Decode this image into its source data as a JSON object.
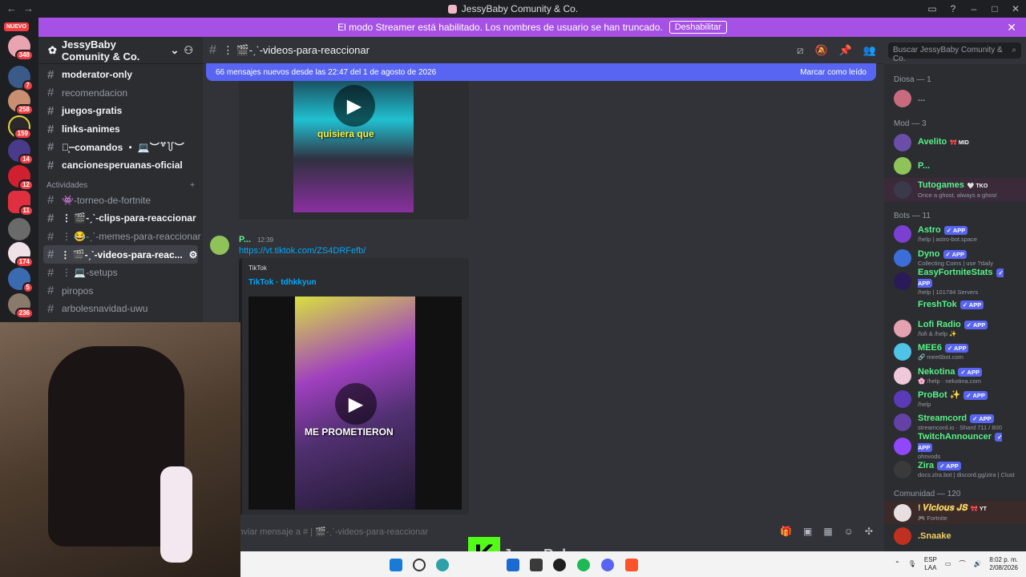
{
  "window": {
    "title": "JessyBaby Comunity & Co."
  },
  "servers": {
    "nuevo": "NUEVO",
    "badges": [
      "348",
      "7",
      "258",
      "159",
      "14",
      "12",
      "11",
      "174",
      "5",
      "236"
    ]
  },
  "streamer_banner": {
    "text": "El modo Streamer está habilitado. Los nombres de usuario se han truncado.",
    "button": "Deshabilitar"
  },
  "guild": {
    "name": "JessyBaby Comunity & Co."
  },
  "channels": [
    {
      "label": "moderator-only",
      "unread": true
    },
    {
      "label": "recomendacion",
      "unread": false
    },
    {
      "label": "juegos-gratis",
      "unread": true
    },
    {
      "label": "links-animes",
      "unread": true
    },
    {
      "label": "╰͙┈comandos ・ 💻︶꒷꒦︶",
      "unread": true
    },
    {
      "label": "cancionesperuanas-oficial",
      "unread": true
    }
  ],
  "category": {
    "label": "Actividades"
  },
  "activity_channels": [
    {
      "label": "👾-torneo-de-fortnite",
      "unread": false
    },
    {
      "label": "⋮ 🎬-ˏˋ-clips-para-reaccionar",
      "unread": true
    },
    {
      "label": "⋮ 😂-ˏˋ-memes-para-reaccionar",
      "unread": false
    },
    {
      "label": "⋮ 🎬-ˏˋ-videos-para-reac...",
      "unread": true,
      "active": true
    },
    {
      "label": "⋮ 💻-setups",
      "unread": false
    },
    {
      "label": "piropos",
      "unread": false
    },
    {
      "label": "arbolesnavidad-uwu",
      "unread": false
    }
  ],
  "channel_header": {
    "name": "⋮ 🎬-ˏˋ-videos-para-reaccionar"
  },
  "search": {
    "placeholder": "Buscar JessyBaby Comunity & Co."
  },
  "new_messages": {
    "text": "66 mensajes nuevos desde las 22:47 del 1 de agosto de 2026",
    "action": "Marcar como leído"
  },
  "messages": {
    "video1_caption": "quisiera que",
    "author": "P...",
    "time": "12:39",
    "link": "https://vt.tiktok.com/ZS4DRFefb/",
    "embed_provider": "TikTok",
    "embed_title": "TikTok · tdhkkyun",
    "video2_caption": "ME PROMETIERON"
  },
  "composer": {
    "placeholder": "Enviar mensaje a # | 🎬-ˏˋ-videos-para-reaccionar"
  },
  "members": {
    "groups": [
      {
        "label": "Diosa — 1",
        "members": [
          {
            "name": "...",
            "sub": "",
            "tag": "",
            "color": "#949ba4",
            "avatar": "#c86b7f"
          }
        ]
      },
      {
        "label": "Mod — 3",
        "members": [
          {
            "name": "Avelito",
            "sub": "",
            "tag": "🎀 MID",
            "color": "#57f287",
            "avatar": "#6b4ea8"
          },
          {
            "name": "P...",
            "sub": "",
            "tag": "",
            "color": "#57f287",
            "avatar": "#8fc35a"
          },
          {
            "name": "Tutogames",
            "sub": "Once a ghost, always a ghost",
            "tag": "🤍 TKO",
            "color": "#57f287",
            "avatar": "#3a3a4a"
          }
        ]
      },
      {
        "label": "Bots — 11",
        "members": [
          {
            "name": "Astro",
            "sub": "/help | astro-bot.space",
            "tag": "✓ APP",
            "color": "#57f287",
            "avatar": "#7b3fd1"
          },
          {
            "name": "Dyno",
            "sub": "Collecting Coins | use ?daily",
            "tag": "✓ APP",
            "color": "#57f287",
            "avatar": "#3b6ed8"
          },
          {
            "name": "EasyFortniteStats",
            "sub": "/help | 101784 Servers",
            "tag": "✓ APP",
            "color": "#57f287",
            "avatar": "#2a1a5a"
          },
          {
            "name": "FreshTok",
            "sub": "",
            "tag": "✓ APP",
            "color": "#57f287",
            "avatar": "#2b2d31"
          },
          {
            "name": "Lofi Radio",
            "sub": "/lofi & /help ✨",
            "tag": "✓ APP",
            "color": "#57f287",
            "avatar": "#e4a1b0"
          },
          {
            "name": "MEE6",
            "sub": "🔗 mee6bot.com",
            "tag": "✓ APP",
            "color": "#57f287",
            "avatar": "#4fc3e8"
          },
          {
            "name": "Nekotina",
            "sub": "🌸 /help · nekotina.com",
            "tag": "✓ APP",
            "color": "#57f287",
            "avatar": "#f0c8d8"
          },
          {
            "name": "ProBot ✨",
            "sub": "/help",
            "tag": "✓ APP",
            "color": "#57f287",
            "avatar": "#5a3ab8"
          },
          {
            "name": "Streamcord",
            "sub": "streamcord.io · Shard 711 / 800",
            "tag": "✓ APP",
            "color": "#57f287",
            "avatar": "#6441a5"
          },
          {
            "name": "TwitchAnnouncer",
            "sub": "ohnvods",
            "tag": "✓ APP",
            "color": "#57f287",
            "avatar": "#9146ff"
          },
          {
            "name": "Zira",
            "sub": "docs.zira.bot | discord.gg/zira | Clust",
            "tag": "✓ APP",
            "color": "#57f287",
            "avatar": "#3a3a3a"
          }
        ]
      },
      {
        "label": "Comunidad — 120",
        "members": [
          {
            "name": "! 𝑽𝒊𝒄𝒊𝒐𝒖𝒔 𝑱𝑺",
            "sub": "🎮 Fortnite",
            "tag": "🎀 YT",
            "color": "#f0d060",
            "avatar": "#e8e0e0"
          },
          {
            "name": ".Snaake",
            "sub": "",
            "tag": "",
            "color": "#f0d060",
            "avatar": "#c03020"
          }
        ]
      }
    ]
  },
  "webcam": {
    "overlay_text": "JessyBaby",
    "logo_letter": "K"
  },
  "taskbar": {
    "lang1": "ESP",
    "lang2": "LAA",
    "time": "8:02 p. m.",
    "date": "2/08/2026"
  },
  "colors": {
    "accent": "#5865f2",
    "streamer": "#a651e6",
    "online": "#23a55a"
  }
}
